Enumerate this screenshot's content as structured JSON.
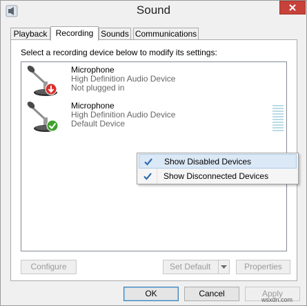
{
  "window": {
    "title": "Sound"
  },
  "tabs": [
    {
      "label": "Playback"
    },
    {
      "label": "Recording"
    },
    {
      "label": "Sounds"
    },
    {
      "label": "Communications"
    }
  ],
  "recording": {
    "instruction": "Select a recording device below to modify its settings:",
    "devices": [
      {
        "name": "Microphone",
        "driver": "High Definition Audio Device",
        "status": "Not plugged in",
        "status_icon": "down-arrow-red-icon"
      },
      {
        "name": "Microphone",
        "driver": "High Definition Audio Device",
        "status": "Default Device",
        "status_icon": "check-green-icon"
      }
    ],
    "level_meter_level": 0
  },
  "context_menu": {
    "items": [
      {
        "label": "Show Disabled Devices",
        "checked": true
      },
      {
        "label": "Show Disconnected Devices",
        "checked": true
      }
    ]
  },
  "panel_buttons": {
    "configure": "Configure",
    "set_default": "Set Default",
    "properties": "Properties"
  },
  "dialog_buttons": {
    "ok": "OK",
    "cancel": "Cancel",
    "apply": "Apply"
  },
  "watermark": "wsxdn.com",
  "colors": {
    "close_button": "#c7423a",
    "menu_highlight": "#dbe8f6",
    "check_blue": "#2e6bb0",
    "status_red": "#d9302c",
    "status_green": "#3da12c"
  }
}
